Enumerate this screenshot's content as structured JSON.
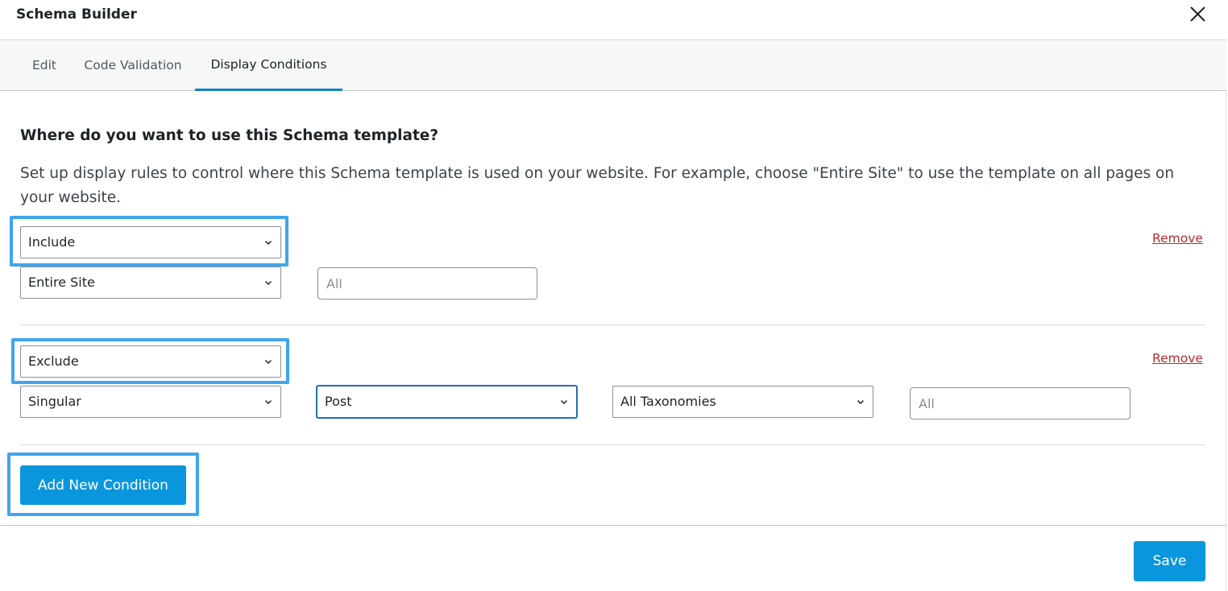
{
  "header": {
    "title": "Schema Builder",
    "close_icon": "close-icon"
  },
  "tabs": [
    {
      "label": "Edit",
      "active": false
    },
    {
      "label": "Code Validation",
      "active": false
    },
    {
      "label": "Display Conditions",
      "active": true
    }
  ],
  "main": {
    "heading": "Where do you want to use this Schema template?",
    "description": "Set up display rules to control where this Schema template is used on your website. For example, choose \"Entire Site\" to use the template on all pages on your website."
  },
  "conditions": [
    {
      "type": "Include",
      "target": "Entire Site",
      "value_placeholder": "All",
      "remove_label": "Remove"
    },
    {
      "type": "Exclude",
      "target": "Singular",
      "post_type": "Post",
      "taxonomy": "All Taxonomies",
      "value_placeholder": "All",
      "remove_label": "Remove"
    }
  ],
  "actions": {
    "add_condition_label": "Add New Condition",
    "save_label": "Save"
  },
  "colors": {
    "accent": "#0a96dc",
    "highlight": "#3fa5ee",
    "remove_link": "#b32d2e"
  }
}
